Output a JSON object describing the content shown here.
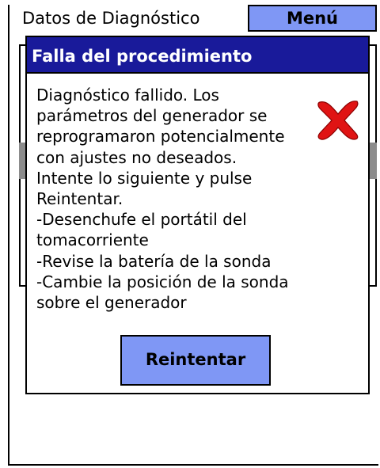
{
  "header": {
    "title": "Datos de Diagnóstico",
    "menu_label": "Menú"
  },
  "dialog": {
    "title": "Falla del procedimiento",
    "message": "Diagnóstico fallido. Los\nparámetros del generador se\nreprogramaron potencialmente\ncon ajustes no deseados.\nIntente lo siguiente y pulse\nReintentar.\n-Desenchufe el portátil del\ntomacorriente\n-Revise la batería de la sonda\n-Cambie la posición de la sonda\nsobre el generador",
    "icon": "error-x-icon",
    "retry_label": "Reintentar"
  },
  "colors": {
    "accent": "#7f97f5",
    "dialog_header": "#191a9a",
    "error_red": "#e01414"
  }
}
